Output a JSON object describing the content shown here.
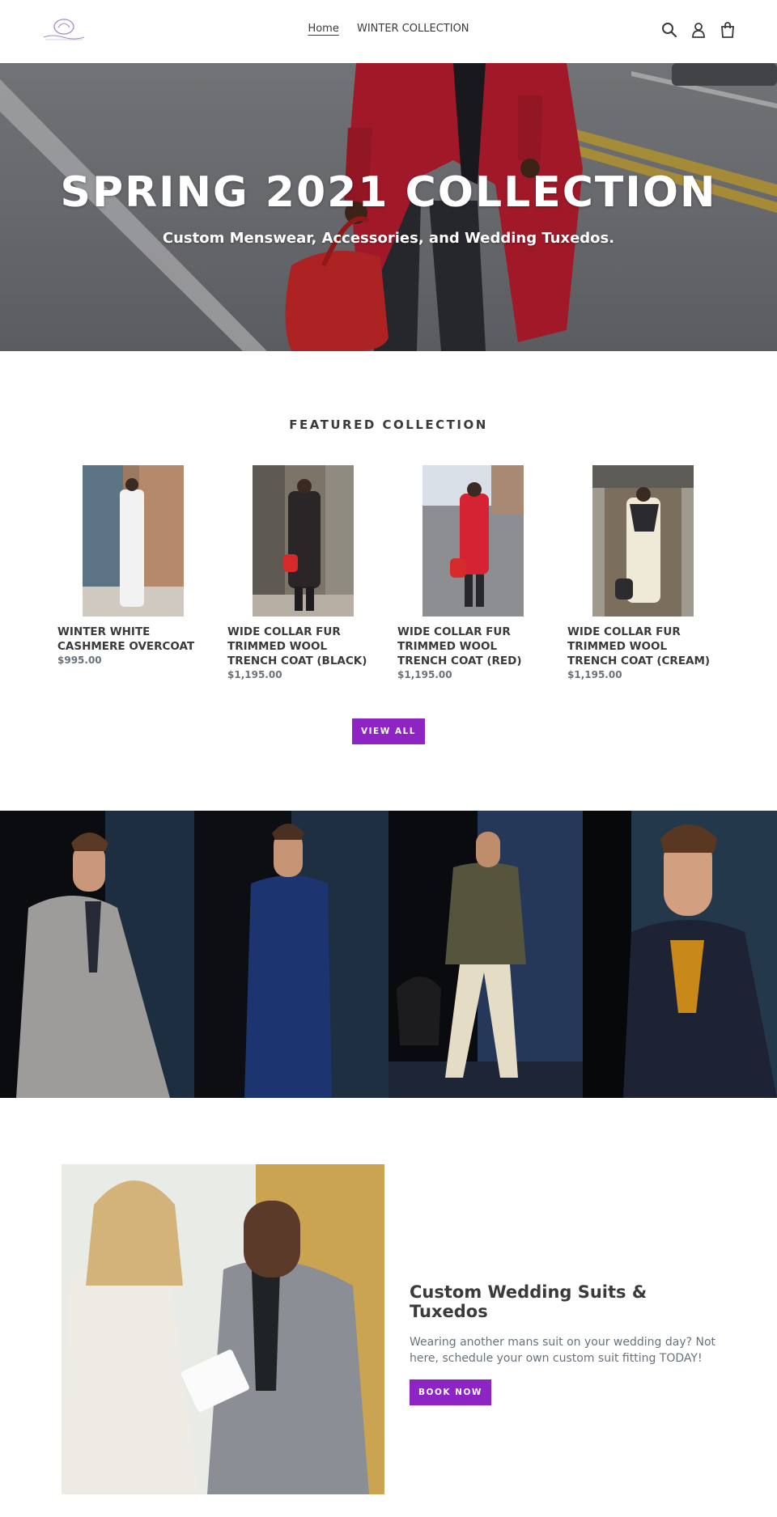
{
  "header": {
    "logo_text": "J. Rainford Collection",
    "nav": [
      {
        "label": "Home",
        "active": true
      },
      {
        "label": "WINTER COLLECTION",
        "active": false
      }
    ],
    "icons": [
      "search-icon",
      "account-icon",
      "cart-icon"
    ]
  },
  "hero": {
    "title": "SPRING 2021 COLLECTION",
    "subtitle": "Custom Menswear, Accessories, and Wedding Tuxedos."
  },
  "featured": {
    "heading": "FEATURED COLLECTION",
    "products": [
      {
        "name": "WINTER WHITE CASHMERE OVERCOAT",
        "price": "$995.00"
      },
      {
        "name": "WIDE COLLAR FUR TRIMMED WOOL TRENCH COAT (BLACK)",
        "price": "$1,195.00"
      },
      {
        "name": "WIDE COLLAR FUR TRIMMED WOOL TRENCH COAT (RED)",
        "price": "$1,195.00"
      },
      {
        "name": "WIDE COLLAR FUR TRIMMED WOOL TRENCH COAT (CREAM)",
        "price": "$1,195.00"
      }
    ],
    "view_all": "VIEW ALL"
  },
  "wedding": {
    "title": "Custom Wedding Suits & Tuxedos",
    "body": "Wearing another mans suit on your wedding day? Not here, schedule your own custom suit fitting TODAY!",
    "button": "BOOK NOW"
  },
  "colors": {
    "accent": "#8e24c4",
    "text": "#3a3a3a",
    "muted": "#69727b"
  }
}
